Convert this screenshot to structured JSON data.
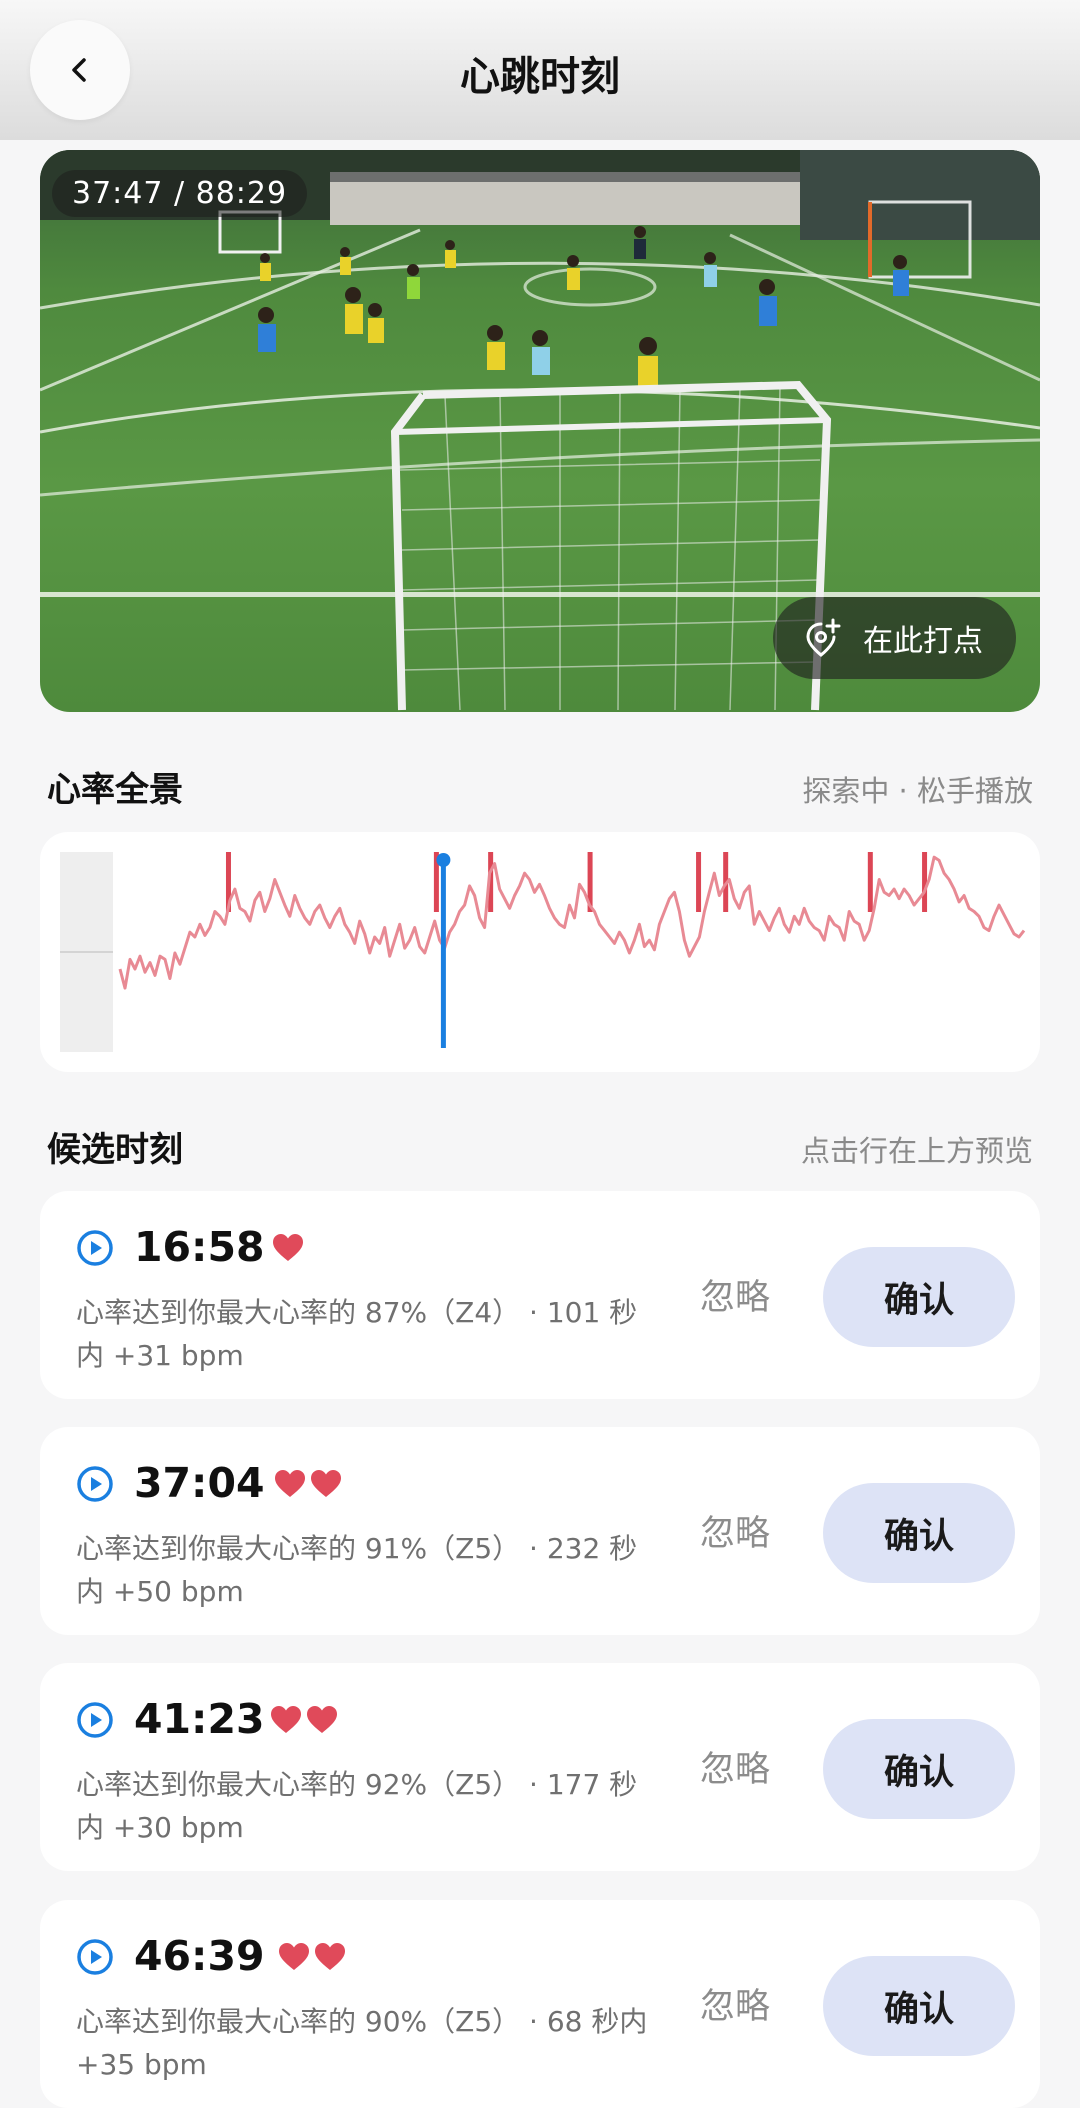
{
  "header": {
    "title": "心跳时刻",
    "back_icon": "chevron-left-icon"
  },
  "video": {
    "time_display": "37:47 / 88:29",
    "mark_label": "在此打点",
    "mark_icon": "pin-plus-icon"
  },
  "overview": {
    "title": "心率全景",
    "hint": "探索中 · 松手播放",
    "chart_data": {
      "type": "line",
      "series": [
        {
          "values": [
            52,
            40,
            58,
            52,
            60,
            50,
            56,
            48,
            60,
            58,
            46,
            62,
            55,
            65,
            75,
            72,
            80,
            73,
            78,
            88,
            85,
            80,
            95,
            102,
            90,
            88,
            82,
            95,
            100,
            88,
            96,
            108,
            100,
            92,
            85,
            98,
            90,
            84,
            80,
            88,
            92,
            84,
            78,
            85,
            90,
            80,
            75,
            68,
            82,
            74,
            62,
            72,
            68,
            78,
            60,
            70,
            80,
            65,
            70,
            78,
            66,
            62,
            72,
            82,
            70,
            65,
            75,
            80,
            88,
            92,
            104,
            98,
            84,
            78,
            112,
            118,
            102,
            96,
            90,
            98,
            104,
            112,
            108,
            100,
            105,
            98,
            90,
            84,
            80,
            78,
            92,
            84,
            105,
            100,
            92,
            88,
            80,
            76,
            72,
            68,
            75,
            70,
            62,
            70,
            80,
            66,
            70,
            64,
            80,
            88,
            96,
            100,
            88,
            70,
            60,
            66,
            72,
            88,
            100,
            112,
            98,
            104,
            108,
            96,
            90,
            100,
            104,
            80,
            88,
            82,
            76,
            84,
            90,
            80,
            75,
            85,
            80,
            90,
            82,
            78,
            76,
            70,
            85,
            80,
            78,
            70,
            88,
            82,
            80,
            70,
            76,
            90,
            108,
            100,
            98,
            102,
            96,
            102,
            98,
            92,
            96,
            100,
            108,
            122,
            120,
            112,
            108,
            102,
            94,
            98,
            90,
            88,
            85,
            78,
            76,
            85,
            92,
            86,
            80,
            74,
            72,
            76
          ]
        }
      ],
      "markers": [
        12,
        35,
        41,
        52,
        64,
        67,
        83,
        89
      ],
      "playhead": 35
    }
  },
  "candidates": {
    "title": "候选时刻",
    "hint": "点击行在上方预览",
    "ignore_label": "忽略",
    "confirm_label": "确认",
    "items": [
      {
        "time": "16:58",
        "hearts": 1,
        "desc": "心率达到你最大心率的 87%（Z4） · 101 秒内 +31 bpm"
      },
      {
        "time": "37:04",
        "hearts": 2,
        "desc": "心率达到你最大心率的 91%（Z5） · 232 秒内 +50 bpm"
      },
      {
        "time": "41:23",
        "hearts": 2,
        "desc": "心率达到你最大心率的 92%（Z5） · 177 秒内 +30 bpm"
      },
      {
        "time": "46:39",
        "hearts": 2,
        "desc": "心率达到你最大心率的 90%（Z5） · 68 秒内 +35 bpm"
      }
    ]
  },
  "colors": {
    "accent": "#1a7fe0",
    "heart": "#e04a5a",
    "line": "#e88a94",
    "marker": "#dc4655",
    "confirm_bg": "#dde3f6"
  }
}
